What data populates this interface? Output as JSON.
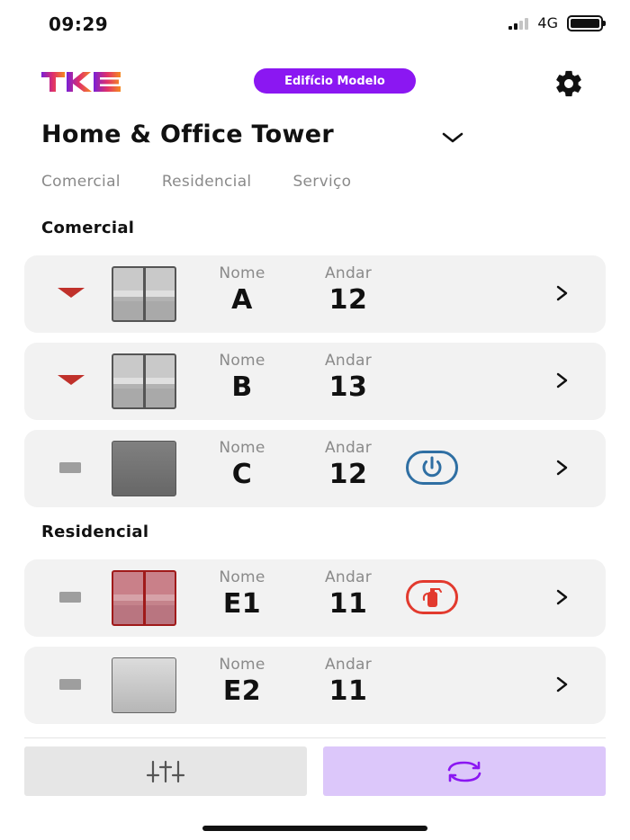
{
  "status_bar": {
    "time": "09:29",
    "network": "4G"
  },
  "header": {
    "logo_text": "TKE",
    "building_label": "Edifício Modelo"
  },
  "tower": {
    "title": "Home & Office Tower"
  },
  "filter_tabs": [
    "Comercial",
    "Residencial",
    "Serviço"
  ],
  "labels": {
    "name": "Nome",
    "floor": "Andar"
  },
  "sections": [
    {
      "title": "Comercial",
      "elevators": [
        {
          "name": "A",
          "floor": "12",
          "status": "moving-down",
          "car": "doors-grey",
          "alert": null
        },
        {
          "name": "B",
          "floor": "13",
          "status": "moving-down",
          "car": "doors-grey",
          "alert": null
        },
        {
          "name": "C",
          "floor": "12",
          "status": "idle",
          "car": "solid-dark",
          "alert": "power-icon"
        }
      ]
    },
    {
      "title": "Residencial",
      "elevators": [
        {
          "name": "E1",
          "floor": "11",
          "status": "idle",
          "car": "doors-red",
          "alert": "fire-extinguisher-icon"
        },
        {
          "name": "E2",
          "floor": "11",
          "status": "idle",
          "car": "solid-light",
          "alert": null
        }
      ]
    }
  ],
  "colors": {
    "brand_purple": "#8b17f2",
    "down_red": "#c0312b",
    "power_blue": "#2f6fa3",
    "fire_red": "#e23a2e",
    "refresh_bg": "#dcc7fa"
  }
}
